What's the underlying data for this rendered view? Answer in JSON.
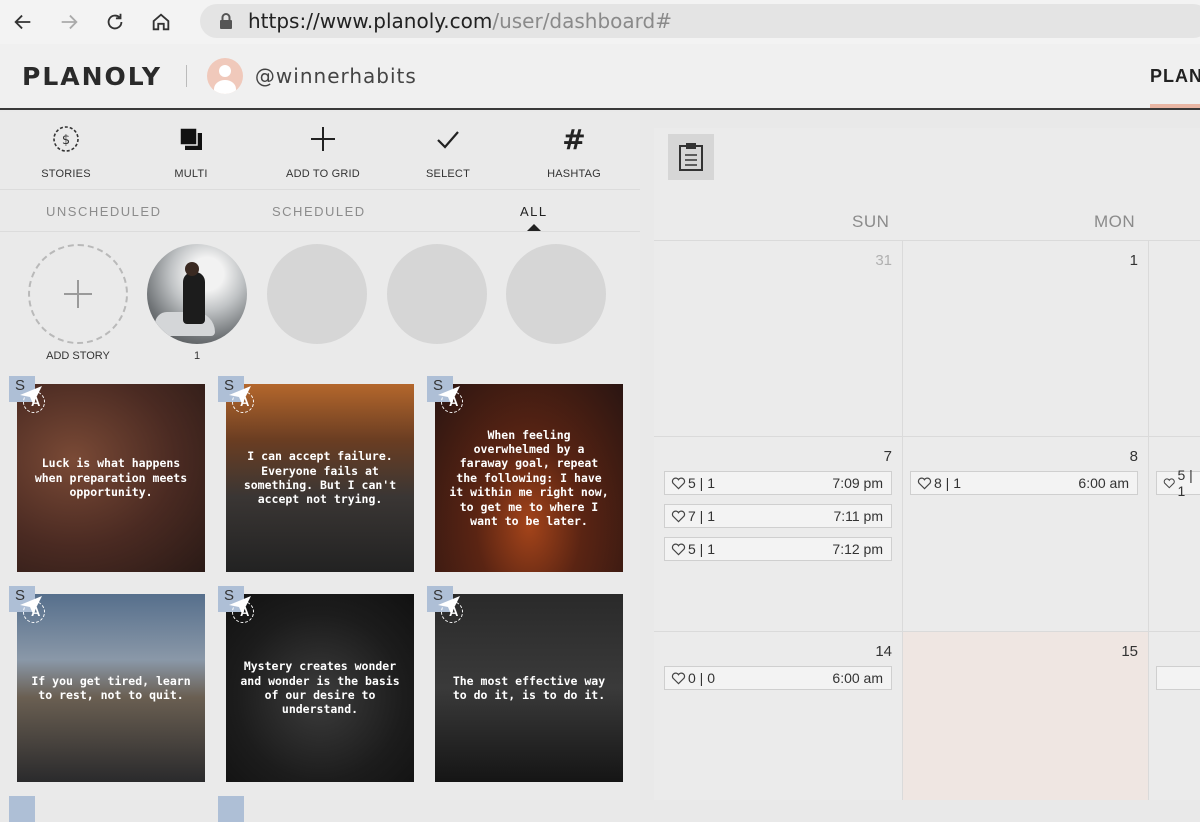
{
  "browser": {
    "url_host": "https://www.planoly.com",
    "url_path": "/user/dashboard#"
  },
  "header": {
    "logo": "PLANOLY",
    "username": "@winnerhabits",
    "tab": "PLAN"
  },
  "toolbar": {
    "items": [
      {
        "label": "STORIES",
        "icon": "stories-icon"
      },
      {
        "label": "MULTI",
        "icon": "multi-icon"
      },
      {
        "label": "ADD TO GRID",
        "icon": "plus-icon"
      },
      {
        "label": "SELECT",
        "icon": "checkmark-icon"
      },
      {
        "label": "HASHTAG",
        "icon": "hashtag-icon"
      }
    ]
  },
  "filters": {
    "unscheduled": "UNSCHEDULED",
    "scheduled": "SCHEDULED",
    "all": "ALL",
    "active": "ALL"
  },
  "stories": {
    "add_label": "ADD STORY",
    "count_label": "1"
  },
  "posts": [
    {
      "caption": "Luck is what happens when preparation meets opportunity.",
      "badge": "S",
      "status": "A"
    },
    {
      "caption": "I can accept failure. Everyone fails at something. But I can't accept not trying.",
      "badge": "S",
      "status": "A"
    },
    {
      "caption": "When feeling overwhelmed by a faraway goal, repeat the following: I have it within me right now, to get me to where I want to be later.",
      "badge": "S",
      "status": "A"
    },
    {
      "caption": "If you get tired, learn to rest, not to quit.",
      "badge": "S",
      "status": "A"
    },
    {
      "caption": "Mystery creates wonder and wonder is the basis of our desire to understand.",
      "badge": "S",
      "status": "A"
    },
    {
      "caption": "The most effective way to do it, is to do it.",
      "badge": "S",
      "status": "A"
    }
  ],
  "calendar": {
    "days": [
      "SUN",
      "MON"
    ],
    "dates": {
      "r1c1": "31",
      "r1c2": "1",
      "r2c1": "7",
      "r2c2": "8",
      "r3c1": "14",
      "r3c2": "15"
    },
    "slots": {
      "s7a": {
        "stats": "5 | 1",
        "time": "7:09 pm"
      },
      "s7b": {
        "stats": "7 | 1",
        "time": "7:11 pm"
      },
      "s7c": {
        "stats": "5 | 1",
        "time": "7:12 pm"
      },
      "s8a": {
        "stats": "8 | 1",
        "time": "6:00 am"
      },
      "s9a": {
        "stats": "5 | 1",
        "time": ""
      },
      "s14a": {
        "stats": "0 | 0",
        "time": "6:00 am"
      }
    }
  },
  "colors": {
    "accent_underline": "#e9b6a4",
    "badge_blue": "#aebfd6",
    "highlight_cell": "#efe6e2"
  }
}
